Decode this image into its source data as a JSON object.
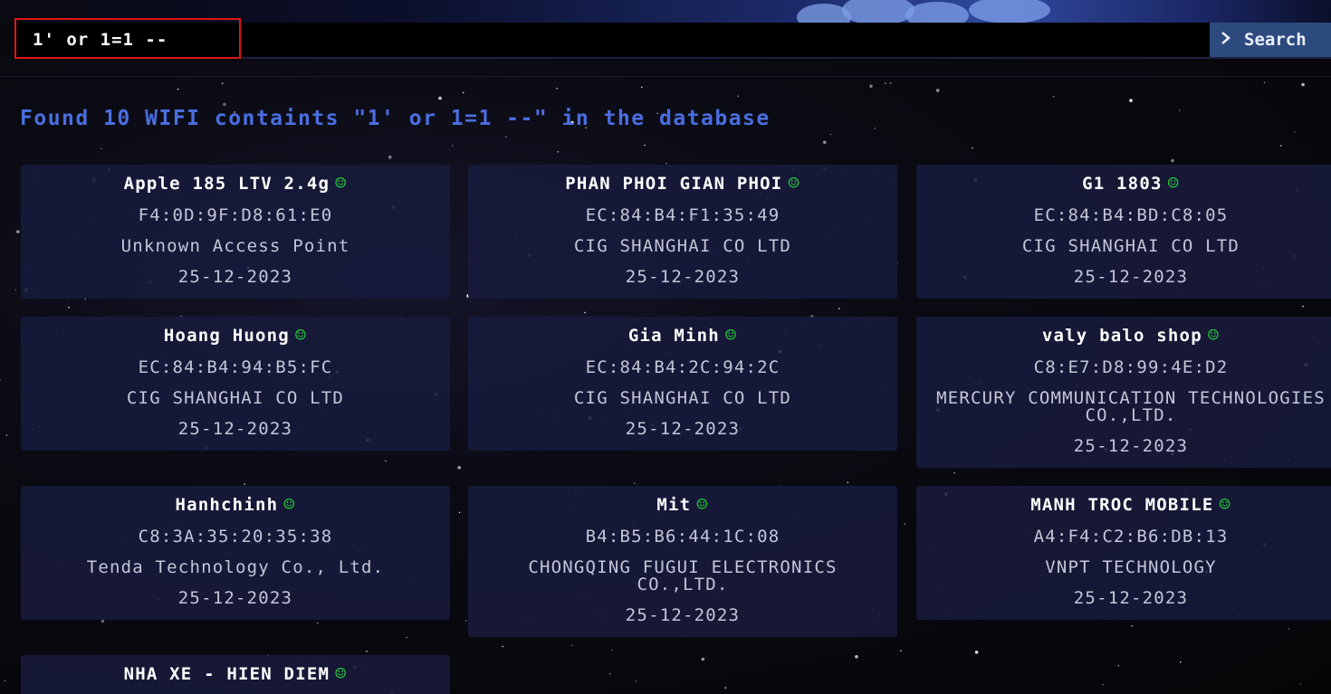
{
  "search": {
    "value": "1' or 1=1 --",
    "button_label": "Search",
    "button_icon": "chevron-right-icon"
  },
  "results": {
    "title": "Found 10 WIFI containts \"1' or 1=1 --\" in the database",
    "status_icon": "smile-icon",
    "status_color": "#22d43a",
    "cards": [
      {
        "name": "Apple 185 LTV 2.4g",
        "mac": "F4:0D:9F:D8:61:E0",
        "vendor": "Unknown Access Point",
        "date": "25-12-2023"
      },
      {
        "name": "PHAN PHOI GIAN PHOI",
        "mac": "EC:84:B4:F1:35:49",
        "vendor": "CIG SHANGHAI CO LTD",
        "date": "25-12-2023"
      },
      {
        "name": "G1 1803",
        "mac": "EC:84:B4:BD:C8:05",
        "vendor": "CIG SHANGHAI CO LTD",
        "date": "25-12-2023"
      },
      {
        "name": "Hoang Huong",
        "mac": "EC:84:B4:94:B5:FC",
        "vendor": "CIG SHANGHAI CO LTD",
        "date": "25-12-2023"
      },
      {
        "name": "Gia Minh",
        "mac": "EC:84:B4:2C:94:2C",
        "vendor": "CIG SHANGHAI CO LTD",
        "date": "25-12-2023"
      },
      {
        "name": "valy balo shop",
        "mac": "C8:E7:D8:99:4E:D2",
        "vendor": "MERCURY COMMUNICATION TECHNOLOGIES CO.,LTD.",
        "date": "25-12-2023"
      },
      {
        "name": "Hanhchinh",
        "mac": "C8:3A:35:20:35:38",
        "vendor": "Tenda Technology Co., Ltd.",
        "date": "25-12-2023"
      },
      {
        "name": "Mit",
        "mac": "B4:B5:B6:44:1C:08",
        "vendor": "CHONGQING FUGUI ELECTRONICS CO.,LTD.",
        "date": "25-12-2023"
      },
      {
        "name": "MANH TROC MOBILE",
        "mac": "A4:F4:C2:B6:DB:13",
        "vendor": "VNPT TECHNOLOGY",
        "date": "25-12-2023"
      },
      {
        "name": "NHA XE - HIEN DIEM",
        "mac": "",
        "vendor": "",
        "date": ""
      }
    ]
  },
  "colors": {
    "title": "#4a6ee0",
    "card_bg": "#181a3c",
    "highlight_border": "#e01515",
    "search_button_bg": "#2d4a7e"
  }
}
